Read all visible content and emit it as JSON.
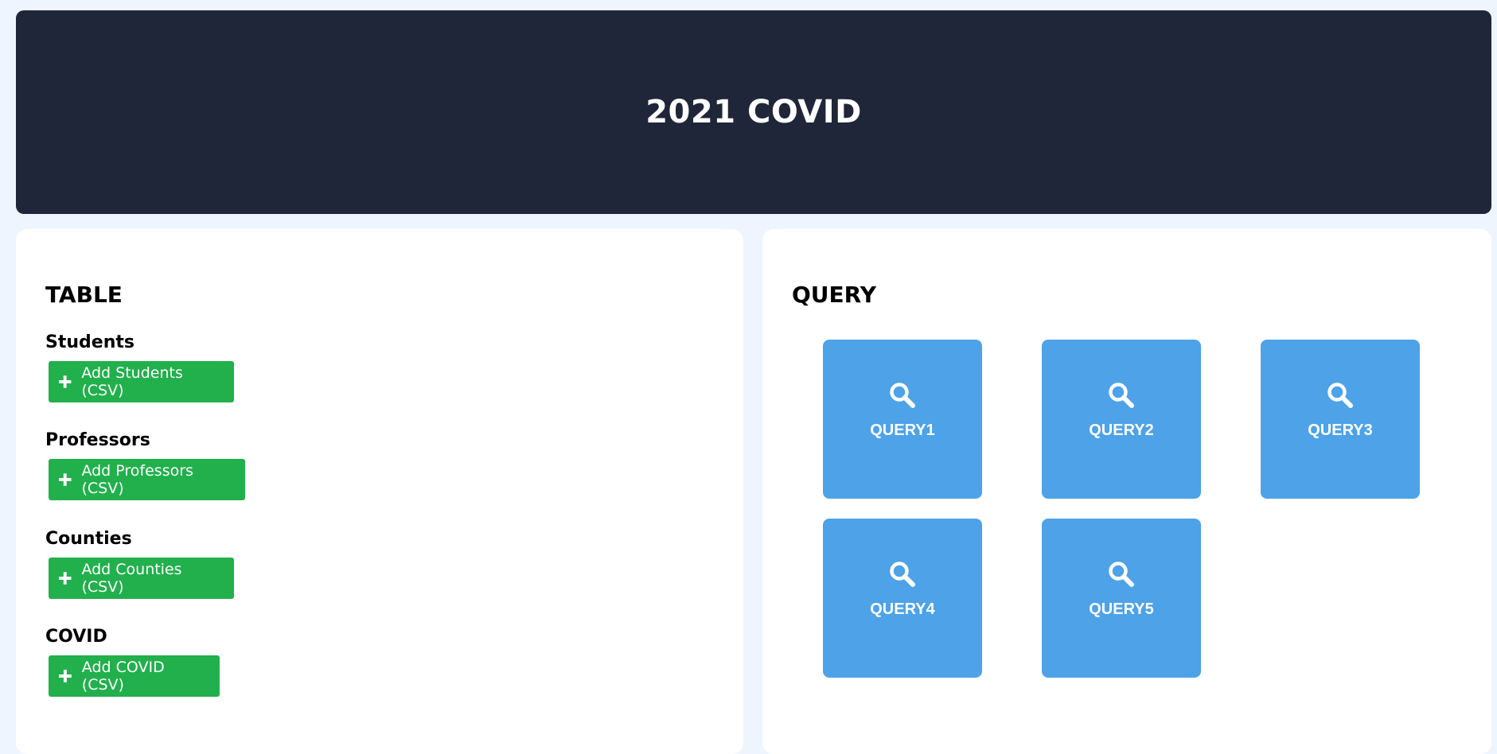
{
  "header": {
    "title": "2021 COVID"
  },
  "table_panel": {
    "heading": "TABLE",
    "groups": [
      {
        "label": "Students",
        "button_label": "Add Students (CSV)"
      },
      {
        "label": "Professors",
        "button_label": "Add Professors (CSV)"
      },
      {
        "label": "Counties",
        "button_label": "Add Counties (CSV)"
      },
      {
        "label": "COVID",
        "button_label": "Add COVID (CSV)"
      }
    ],
    "button_icon": "plus-icon"
  },
  "query_panel": {
    "heading": "QUERY",
    "tiles": [
      {
        "label": "QUERY1",
        "icon": "search-icon"
      },
      {
        "label": "QUERY2",
        "icon": "search-icon"
      },
      {
        "label": "QUERY3",
        "icon": "search-icon"
      },
      {
        "label": "QUERY4",
        "icon": "search-icon"
      },
      {
        "label": "QUERY5",
        "icon": "search-icon"
      }
    ]
  },
  "colors": {
    "page_background": "#eff5fe",
    "header_background": "#202639",
    "add_button": "#21b04c",
    "query_tile": "#4da2e8",
    "text_on_accent": "#ffffff"
  }
}
